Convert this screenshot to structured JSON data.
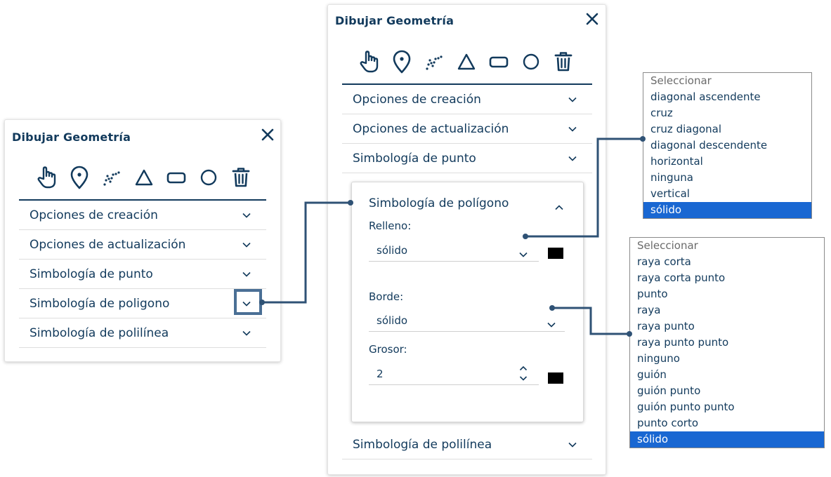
{
  "left_panel": {
    "title": "Dibujar Geometría",
    "tools": [
      "hand-icon",
      "map-pin-icon",
      "polyline-icon",
      "triangle-icon",
      "rectangle-icon",
      "circle-icon",
      "trash-icon"
    ],
    "sections": [
      {
        "label": "Opciones de creación"
      },
      {
        "label": "Opciones de actualización"
      },
      {
        "label": "Simbología de punto"
      },
      {
        "label": "Simbología de poligono"
      },
      {
        "label": "Simbología de polilínea"
      }
    ]
  },
  "right_panel": {
    "title": "Dibujar Geometría",
    "sections_top": [
      {
        "label": "Opciones de creación"
      },
      {
        "label": "Opciones de actualización"
      },
      {
        "label": "Simbología de punto"
      }
    ],
    "polygon_section": {
      "label": "Simbología de polígono",
      "fill_label": "Relleno:",
      "fill_value": "sólido",
      "border_label": "Borde:",
      "border_value": "sólido",
      "width_label": "Grosor:",
      "width_value": "2"
    },
    "sections_bottom": [
      {
        "label": "Simbología de polilínea"
      }
    ]
  },
  "fill_options": {
    "placeholder": "Seleccionar",
    "items": [
      "diagonal ascendente",
      "cruz",
      "cruz diagonal",
      "diagonal descendente",
      "horizontal",
      "ninguna",
      "vertical",
      "sólido"
    ],
    "selected": "sólido"
  },
  "border_options": {
    "placeholder": "Seleccionar",
    "items": [
      "raya corta",
      "raya corta punto",
      "punto",
      "raya",
      "raya punto",
      "raya punto punto",
      "ninguno",
      "guión",
      "guión punto",
      "guión punto punto",
      "punto corto",
      "sólido"
    ],
    "selected": "sólido"
  },
  "colors": {
    "text": "#123a5c",
    "accent_connector": "#2f5275",
    "selected_bg": "#1967d2",
    "swatch": "#000000"
  }
}
